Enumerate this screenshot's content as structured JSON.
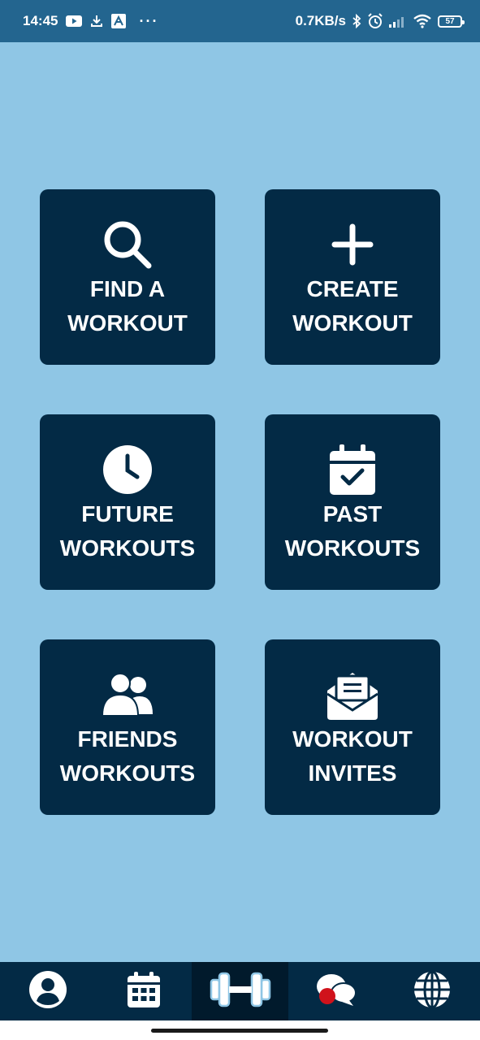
{
  "status_bar": {
    "time": "14:45",
    "network_speed": "0.7KB/s",
    "battery_level": "57",
    "more_indicator": "···",
    "icons": [
      "youtube-icon",
      "download-icon",
      "app-icon",
      "bluetooth-icon",
      "alarm-icon",
      "signal-icon",
      "wifi-icon",
      "battery-icon"
    ]
  },
  "tiles": [
    {
      "line1": "FIND A",
      "line2": "WORKOUT",
      "icon": "search-icon"
    },
    {
      "line1": "CREATE",
      "line2": "WORKOUT",
      "icon": "plus-icon"
    },
    {
      "line1": "FUTURE",
      "line2": "WORKOUTS",
      "icon": "clock-icon"
    },
    {
      "line1": "PAST",
      "line2": "WORKOUTS",
      "icon": "calendar-check-icon"
    },
    {
      "line1": "FRIENDS",
      "line2": "WORKOUTS",
      "icon": "users-icon"
    },
    {
      "line1": "WORKOUT",
      "line2": "INVITES",
      "icon": "envelope-open-icon"
    }
  ],
  "bottom_nav": {
    "items": [
      "profile-icon",
      "calendar-icon",
      "dumbbell-icon",
      "chat-icon",
      "globe-icon"
    ],
    "active": "dumbbell-icon"
  },
  "colors": {
    "background": "#8fc6e5",
    "status_bar": "#23658f",
    "tile": "#032a45",
    "nav": "#032a45",
    "nav_active": "#011a2c",
    "notification_dot": "#d0121b"
  }
}
